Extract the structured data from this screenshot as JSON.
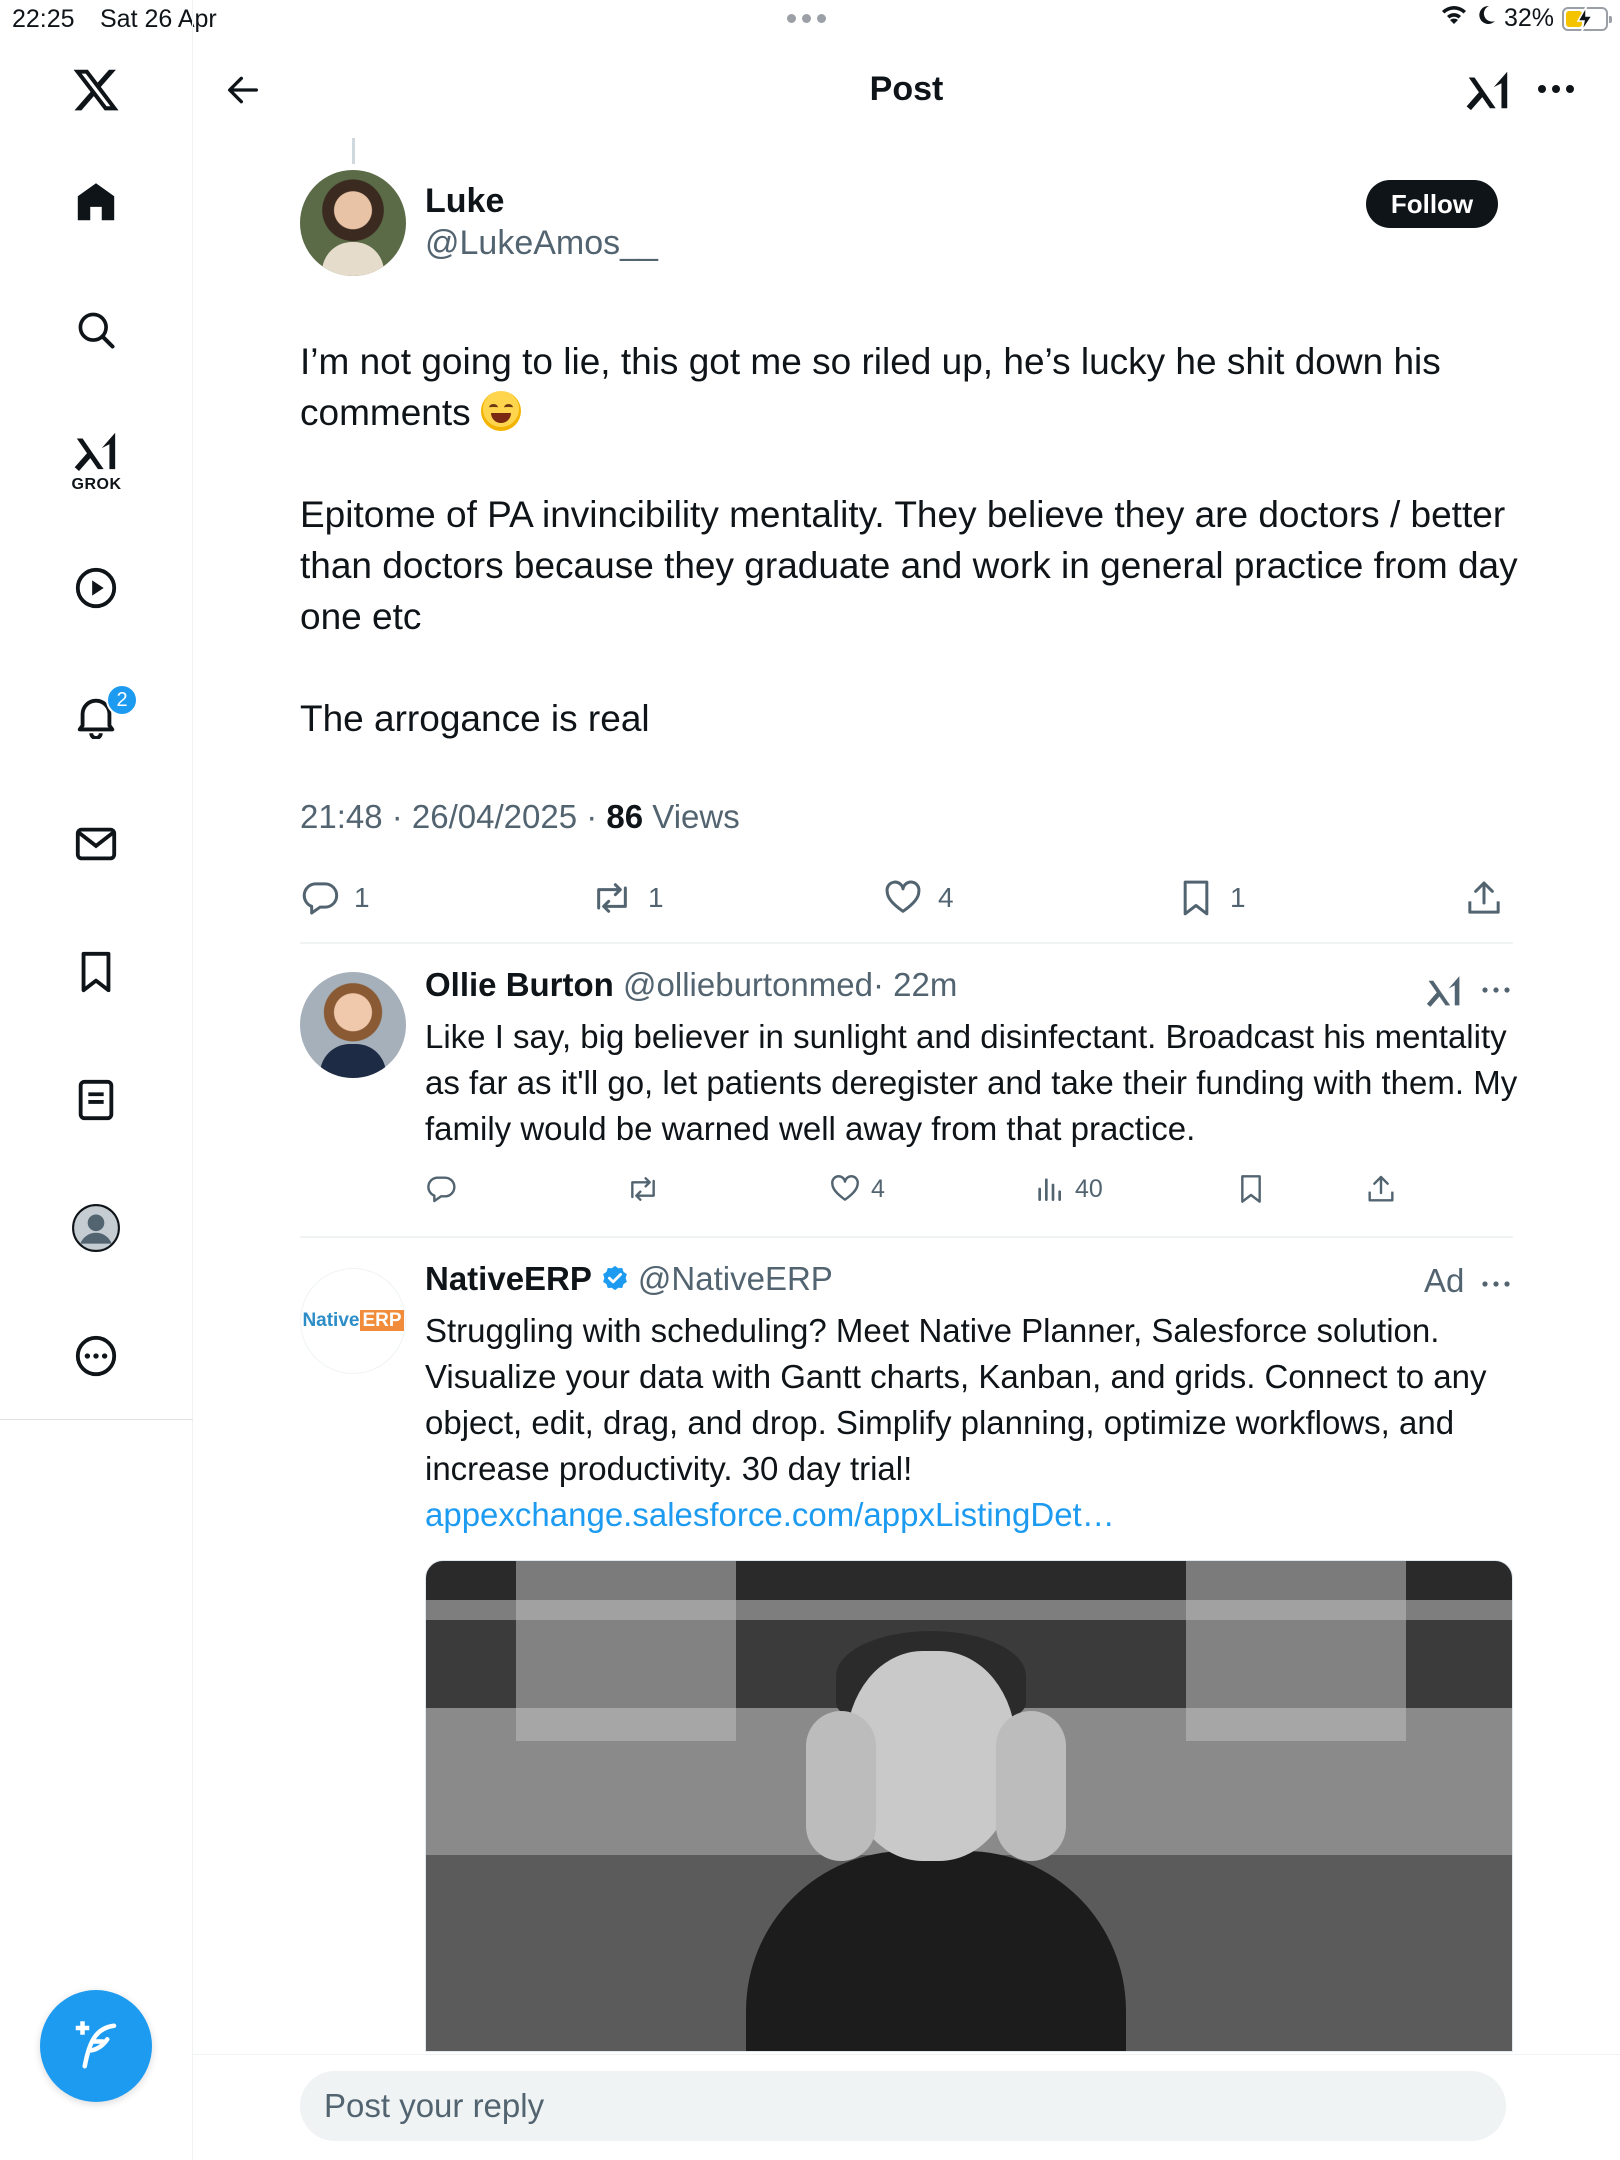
{
  "status_bar": {
    "time": "22:25",
    "date": "Sat 26 Apr",
    "battery": "32%"
  },
  "sidebar": {
    "items": [
      {
        "name": "home",
        "icon": "home-icon"
      },
      {
        "name": "explore",
        "icon": "search-icon"
      },
      {
        "name": "grok",
        "icon": "grok-icon",
        "label": "GROK"
      },
      {
        "name": "videos",
        "icon": "play-icon"
      },
      {
        "name": "notifications",
        "icon": "bell-icon",
        "badge": "2"
      },
      {
        "name": "messages",
        "icon": "envelope-icon"
      },
      {
        "name": "bookmarks",
        "icon": "bookmark-icon"
      },
      {
        "name": "lists",
        "icon": "list-icon"
      },
      {
        "name": "profile",
        "icon": "profile-icon"
      },
      {
        "name": "more",
        "icon": "more-circle-icon"
      }
    ],
    "compose_icon": "compose-post-icon"
  },
  "header": {
    "title": "Post"
  },
  "post": {
    "author_name": "Luke",
    "author_handle": "@LukeAmos__",
    "follow_label": "Follow",
    "text_1": "I’m not going to lie, this got me so riled up, he’s lucky he shit down his comments",
    "text_2": "Epitome of PA invincibility mentality. They believe they are doctors / better than doctors because they graduate and work in general practice from day one etc",
    "text_3": "The arrogance is real",
    "timestamp": "21:48 · 26/04/2025 · ",
    "views_count": "86",
    "views_label": " Views",
    "stats": {
      "replies": "1",
      "reposts": "1",
      "likes": "4",
      "bookmarks": "1"
    }
  },
  "reply": {
    "name": "Ollie Burton",
    "handle": "@ollieburtonmed",
    "time": "· 22m",
    "text": "Like I say, big believer in sunlight and disinfectant. Broadcast his mentality as far as it'll go, let patients deregister and take their funding with them. My family would be warned well away from that practice.",
    "stats": {
      "likes": "4",
      "views": "40"
    }
  },
  "ad": {
    "logo_text": "Native",
    "logo_accent": "ERP",
    "name": "NativeERP",
    "handle": "@NativeERP",
    "tag": "Ad",
    "text": "Struggling with scheduling? Meet Native Planner,  Salesforce solution. Visualize your data with Gantt charts, Kanban, and grids. Connect to any object, edit, drag, and drop. Simplify planning, optimize workflows, and increase productivity.  30 day trial! ",
    "link": "appexchange.salesforce.com/appxListingDet…"
  },
  "reply_box": {
    "placeholder": "Post your reply"
  },
  "colors": {
    "accent": "#1d9bf0",
    "text": "#0f1419",
    "secondary": "#536471"
  }
}
